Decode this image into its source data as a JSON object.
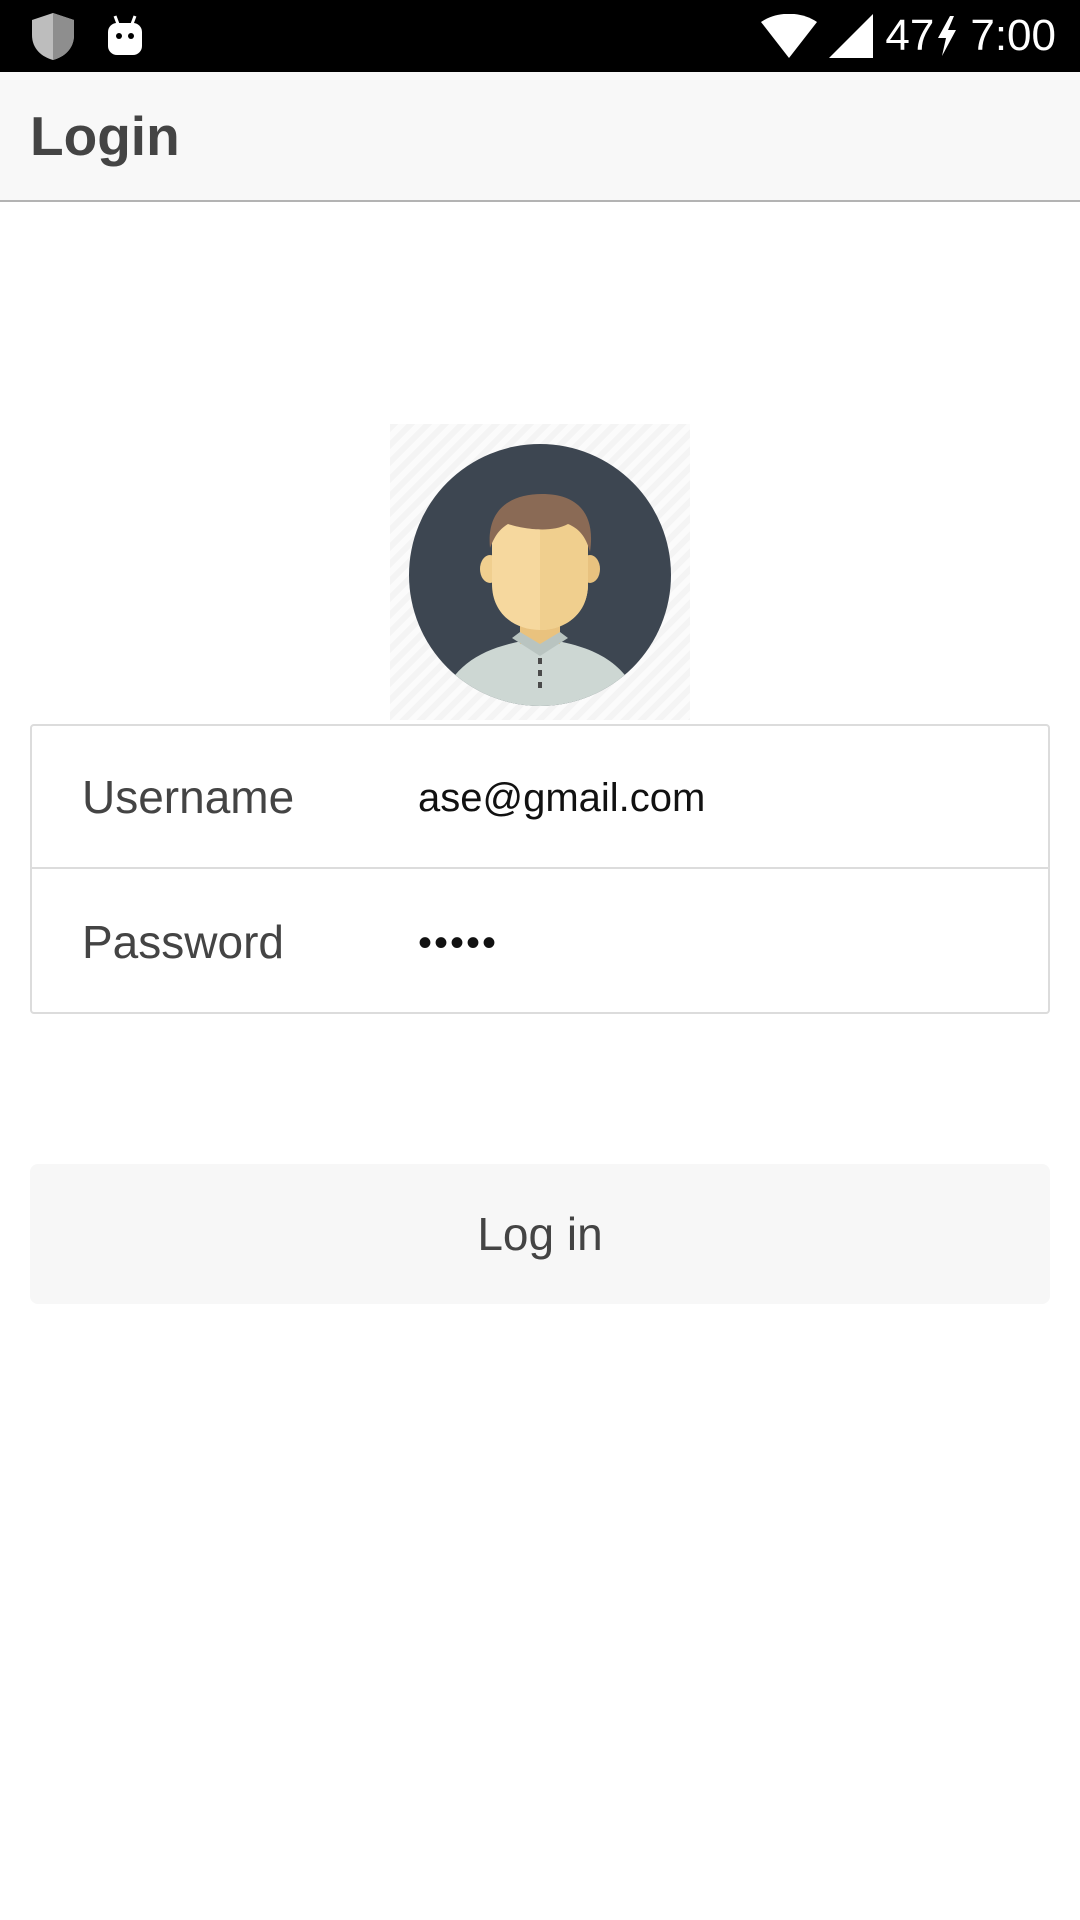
{
  "status_bar": {
    "left_icons": [
      "shield-icon",
      "android-robot-icon"
    ],
    "battery_level": "47",
    "time": "7:00",
    "right_icons": [
      "wifi-icon",
      "cell-signal-icon",
      "charging-bolt-icon"
    ]
  },
  "app_bar": {
    "title": "Login"
  },
  "avatar": {
    "icon": "user-avatar-icon"
  },
  "form": {
    "username_label": "Username",
    "username_value": "ase@gmail.com",
    "password_label": "Password",
    "password_value": "•••••"
  },
  "login_button": {
    "label": "Log in"
  },
  "colors": {
    "status_bar_bg": "#000000",
    "app_bar_bg": "#f8f8f8",
    "text": "#444444",
    "border": "#dcdcdc",
    "button_bg": "#f7f7f7",
    "avatar_bg": "#3d4651",
    "avatar_skin": "#f6d89e",
    "avatar_hair": "#8a6a55",
    "avatar_shirt": "#cdd7d3"
  }
}
